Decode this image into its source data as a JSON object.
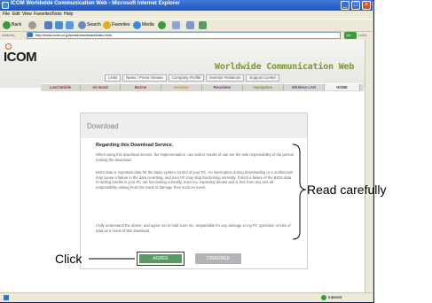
{
  "browser": {
    "title": "ICOM Worldwide Communication Web - Microsoft Internet Explorer",
    "menu": [
      "File",
      "Edit",
      "View",
      "Favorites",
      "Tools",
      "Help"
    ],
    "toolbar": {
      "back": "Back",
      "search": "Search",
      "favorites": "Favorites",
      "media": "Media"
    },
    "address_label": "Address",
    "address": "http://www.icom.co.jp/world/download/index.html",
    "go_label": "Go",
    "links_label": "Links",
    "status_zone": "Internet"
  },
  "header": {
    "logo": "ICOM",
    "title": "Worldwide Communication Web",
    "top_links": [
      "Links",
      "News / Press release",
      "Company Profile",
      "Investor Relations",
      "Support Center"
    ],
    "nav": [
      {
        "label": "Land Mobile",
        "color": "#b0301e"
      },
      {
        "label": "Air Band",
        "color": "#b0301e"
      },
      {
        "label": "Marine",
        "color": "#b0301e"
      },
      {
        "label": "Amateur",
        "color": "#d8861c"
      },
      {
        "label": "Receivers",
        "color": "#8a2a8a"
      },
      {
        "label": "Navigation",
        "color": "#7a9a2a"
      },
      {
        "label": "Wireless LAN",
        "color": "#4a4a90"
      },
      {
        "label": "HOME",
        "color": "#444444"
      }
    ]
  },
  "download": {
    "title": "Download",
    "section_title": "Regarding this Download Service.",
    "paragraphs": [
      "When using this download service, the implementation, use and/or results of use are the sole responsibility of the person making the download.",
      "BIOS data is important data for the basic system control of your PC. An interruption during downloading or a malfunction may cause a failure in the data re-writing, and your PC may stop functioning normally. If such a failure of the BIOS data re-writing results in your PC not functioning normally, Icom Inc. expressly denies and is free from any and all responsibility arising from the result of damage from such an event.",
      "I fully understand the above, and agree not to hold Icom Inc. responsible for any damage to my PC operation or loss of data as a result of this download."
    ],
    "agree_label": "AGREE",
    "disagree_label": "DISAGREE"
  },
  "annotations": {
    "read_label": "Read carefully",
    "click_label": "Click"
  }
}
